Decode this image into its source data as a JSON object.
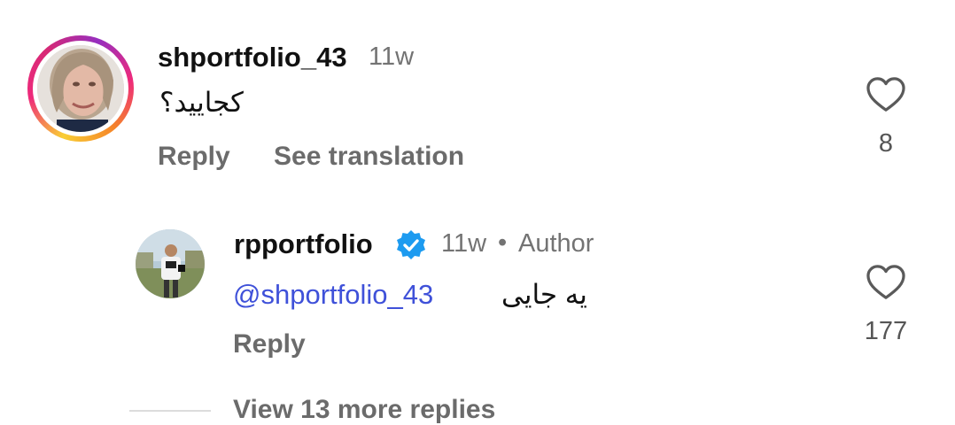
{
  "comments": [
    {
      "username": "shportfolio_43",
      "time": "11w",
      "text": "کجایید؟",
      "actions": {
        "reply": "Reply",
        "translate": "See translation"
      },
      "likes": "8"
    }
  ],
  "reply": {
    "username": "rpportfolio",
    "time": "11w",
    "separator": "•",
    "author_label": "Author",
    "mention": "@shportfolio_43",
    "text": "یه جایی",
    "actions": {
      "reply": "Reply"
    },
    "likes": "177",
    "badge": "verified-badge-icon"
  },
  "view_more": "View 13 more replies",
  "colors": {
    "mention": "#3f51d9",
    "verified": "#1d9bf0"
  }
}
